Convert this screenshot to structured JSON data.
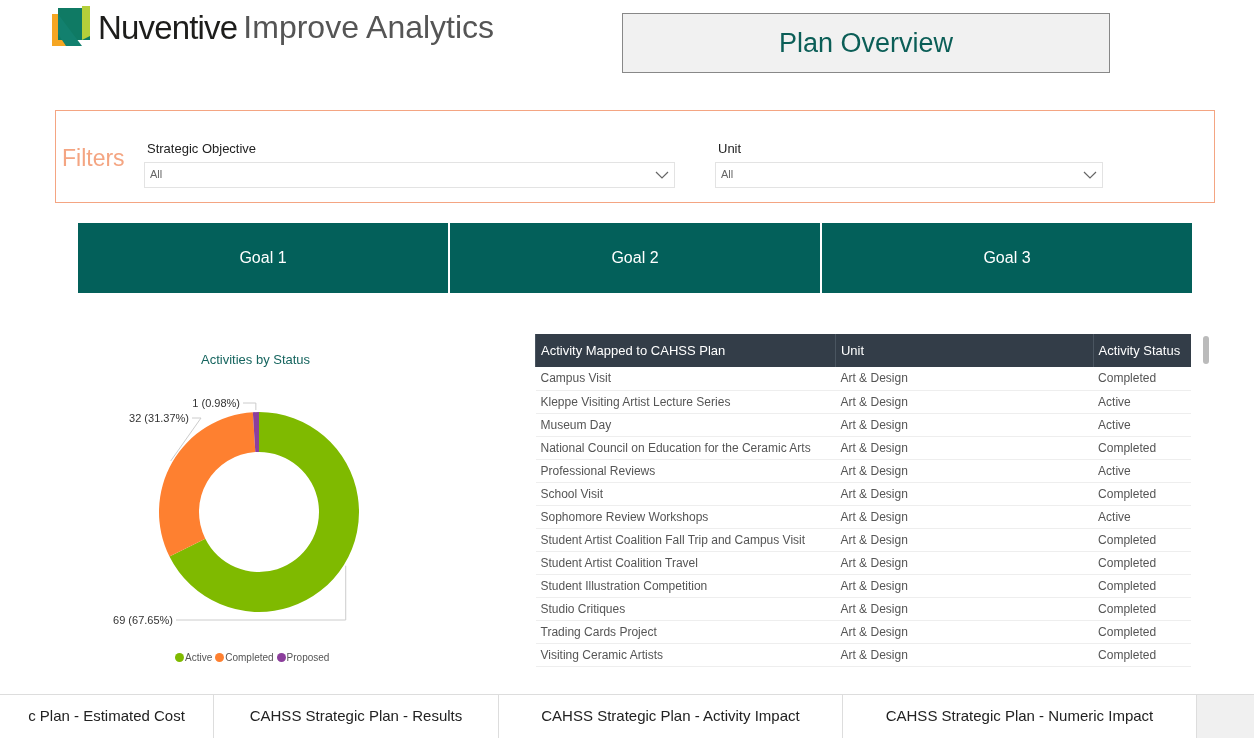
{
  "header": {
    "brand": "Nuventive",
    "product": "Improve Analytics",
    "page_title": "Plan Overview"
  },
  "filters": {
    "label": "Filters",
    "fields": [
      {
        "label": "Strategic Objective",
        "value": "All"
      },
      {
        "label": "Unit",
        "value": "All"
      }
    ]
  },
  "goals": [
    "Goal 1",
    "Goal 2",
    "Goal 3"
  ],
  "chart": {
    "chart_data": {
      "type": "donut",
      "title": "Activities by Status",
      "categories": [
        "Active",
        "Completed",
        "Proposed"
      ],
      "values": [
        69,
        32,
        1
      ],
      "legend": true,
      "colors": [
        "#7fba00",
        "#fe8030",
        "#8c3f9c"
      ],
      "value_labels": [
        "69 (67.65%)",
        "32 (31.37%)",
        "1 (0.98%)"
      ]
    }
  },
  "table": {
    "columns": [
      "Activity Mapped to CAHSS Plan",
      "Unit",
      "Activity Status"
    ],
    "rows": [
      [
        "Campus Visit",
        "Art & Design",
        "Completed"
      ],
      [
        "Kleppe Visiting Artist Lecture Series",
        "Art & Design",
        "Active"
      ],
      [
        "Museum Day",
        "Art & Design",
        "Active"
      ],
      [
        "National Council on Education for the Ceramic Arts",
        "Art & Design",
        "Completed"
      ],
      [
        "Professional Reviews",
        "Art & Design",
        "Active"
      ],
      [
        "School Visit",
        "Art & Design",
        "Completed"
      ],
      [
        "Sophomore Review Workshops",
        "Art & Design",
        "Active"
      ],
      [
        "Student Artist Coalition Fall Trip and Campus Visit",
        "Art & Design",
        "Completed"
      ],
      [
        "Student Artist Coalition Travel",
        "Art & Design",
        "Completed"
      ],
      [
        "Student Illustration Competition",
        "Art & Design",
        "Completed"
      ],
      [
        "Studio Critiques",
        "Art & Design",
        "Completed"
      ],
      [
        "Trading Cards Project",
        "Art & Design",
        "Completed"
      ],
      [
        "Visiting Ceramic Artists",
        "Art & Design",
        "Completed"
      ]
    ]
  },
  "page_tabs": [
    "c Plan - Estimated Cost",
    "CAHSS Strategic Plan - Results",
    "CAHSS Strategic Plan - Activity Impact",
    "CAHSS Strategic Plan - Numeric Impact"
  ]
}
